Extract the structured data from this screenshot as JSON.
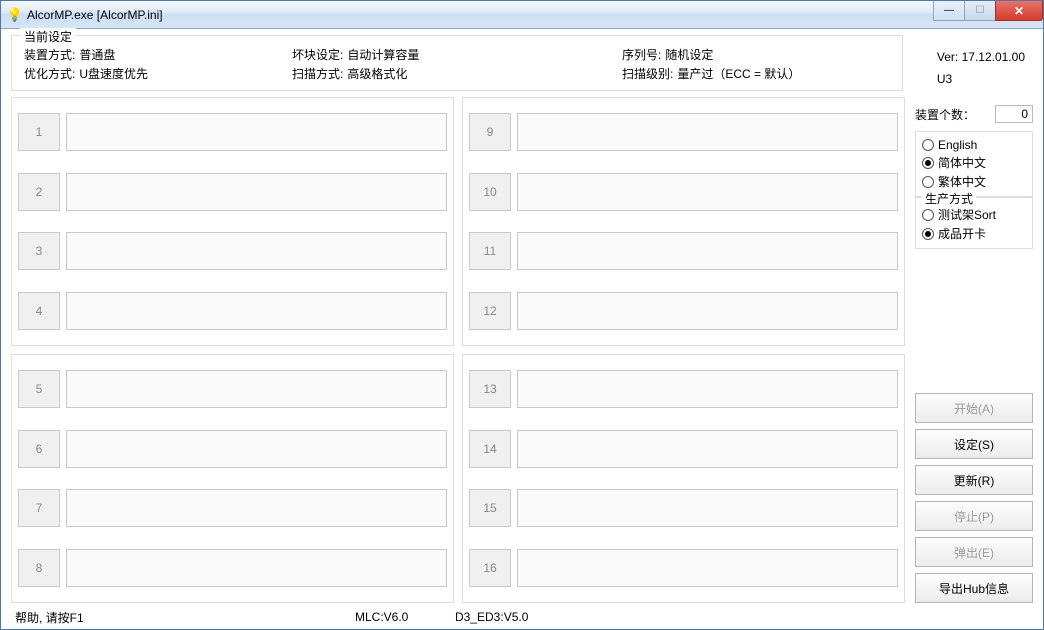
{
  "window": {
    "title": "AlcorMP.exe [AlcorMP.ini]"
  },
  "settings": {
    "legend": "当前设定",
    "row1": {
      "c1_label": "装置方式:",
      "c1_value": "普通盘",
      "c2_label": "坏块设定:",
      "c2_value": "自动计算容量",
      "c3_label": "序列号:",
      "c3_value": "随机设定"
    },
    "row2": {
      "c1_label": "优化方式:",
      "c1_value": "U盘速度优先",
      "c2_label": "扫描方式:",
      "c2_value": "高级格式化",
      "c3_label": "扫描级别:",
      "c3_value": "量产过（ECC = 默认）"
    }
  },
  "version": {
    "ver_label": "Ver:",
    "ver_value": "17.12.01.00",
    "sub": "U3"
  },
  "count": {
    "label": "装置个数：",
    "value": "0"
  },
  "language": {
    "options": [
      {
        "label": "English",
        "selected": false
      },
      {
        "label": "简体中文",
        "selected": true
      },
      {
        "label": "繁体中文",
        "selected": false
      }
    ]
  },
  "prodmode": {
    "legend": "生产方式",
    "options": [
      {
        "label": "测试架Sort",
        "selected": false
      },
      {
        "label": "成品开卡",
        "selected": true
      }
    ]
  },
  "buttons": {
    "start": "开始(A)",
    "setup": "设定(S)",
    "refresh": "更新(R)",
    "stop": "停止(P)",
    "eject": "弹出(E)",
    "exporthub": "导出Hub信息"
  },
  "slots": {
    "p1": [
      "1",
      "2",
      "3",
      "4"
    ],
    "p2": [
      "9",
      "10",
      "11",
      "12"
    ],
    "p3": [
      "5",
      "6",
      "7",
      "8"
    ],
    "p4": [
      "13",
      "14",
      "15",
      "16"
    ]
  },
  "status": {
    "help": "帮助, 请按F1",
    "mlc": "MLC:V6.0",
    "d3": "D3_ED3:V5.0"
  }
}
